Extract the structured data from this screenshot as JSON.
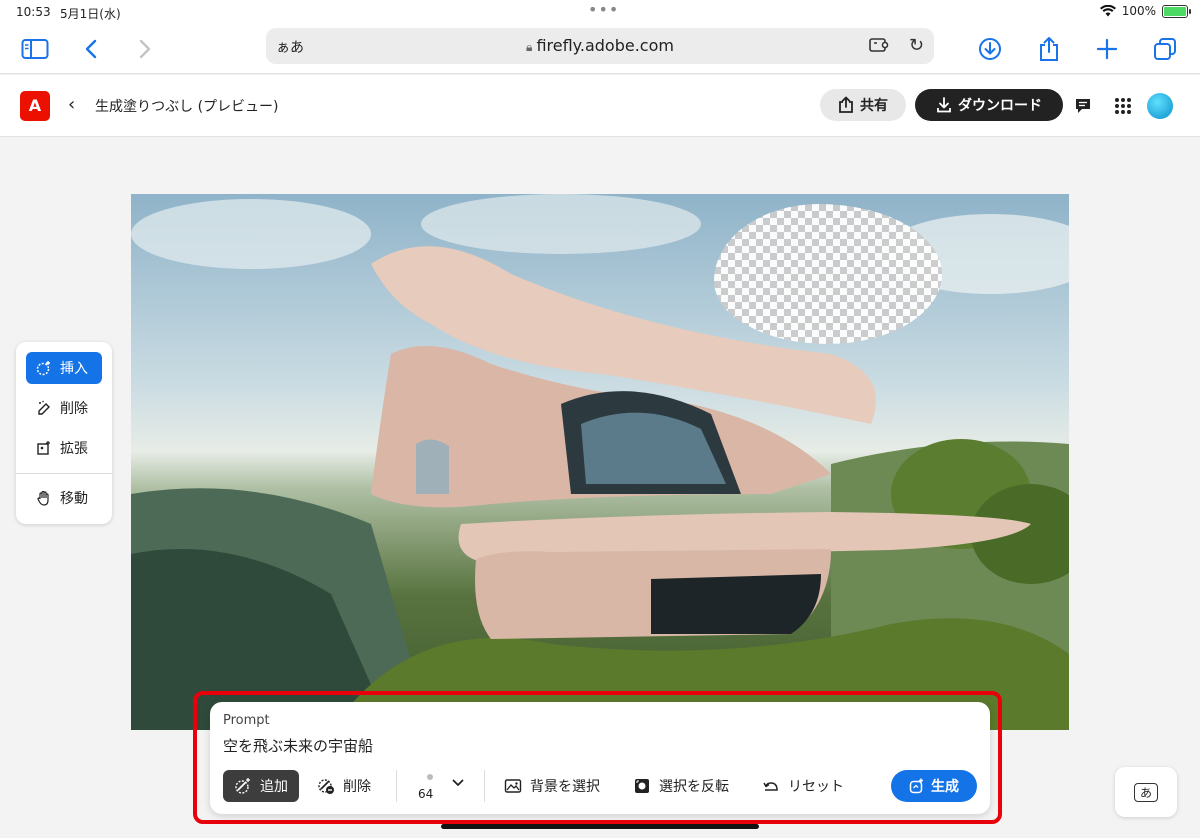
{
  "status_bar": {
    "time": "10:53",
    "date": "5月1日(水)",
    "battery": "100%"
  },
  "browser": {
    "aa_label": "ぁあ",
    "url": "firefly.adobe.com"
  },
  "header": {
    "logo": "A",
    "title": "生成塗りつぶし (プレビュー)",
    "share_label": "共有",
    "download_label": "ダウンロード"
  },
  "tools": [
    {
      "label": "挿入",
      "icon": "insert-icon",
      "active": true
    },
    {
      "label": "削除",
      "icon": "remove-icon",
      "active": false
    },
    {
      "label": "拡張",
      "icon": "expand-icon",
      "active": false
    },
    {
      "label": "移動",
      "icon": "hand-icon",
      "active": false
    }
  ],
  "prompt": {
    "label": "Prompt",
    "value": "空を飛ぶ未来の宇宙船",
    "add_label": "追加",
    "subtract_label": "削除",
    "brush_size": "64",
    "select_bg_label": "背景を選択",
    "invert_label": "選択を反転",
    "reset_label": "リセット",
    "generate_label": "生成"
  },
  "keyboard_button": "あ",
  "colors": {
    "accent": "#1473e6",
    "highlight_outline": "#e8000b",
    "adobe_red": "#eb1000"
  }
}
